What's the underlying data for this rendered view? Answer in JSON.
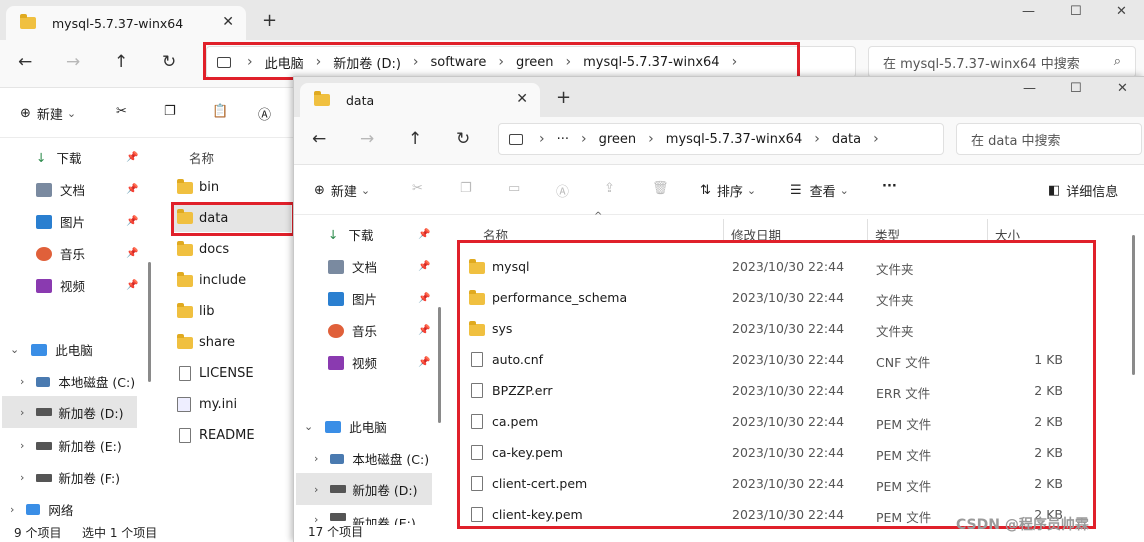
{
  "back_window": {
    "tab_title": "mysql-5.7.37-winx64",
    "breadcrumb": [
      "此电脑",
      "新加卷 (D:)",
      "software",
      "green",
      "mysql-5.7.37-winx64"
    ],
    "search_placeholder": "在 mysql-5.7.37-winx64 中搜索",
    "new_label": "新建",
    "sidebar": {
      "quick": [
        {
          "label": "下载"
        },
        {
          "label": "文档"
        },
        {
          "label": "图片"
        },
        {
          "label": "音乐"
        },
        {
          "label": "视频"
        }
      ],
      "this_pc": "此电脑",
      "drives": [
        {
          "label": "本地磁盘 (C:)"
        },
        {
          "label": "新加卷 (D:)"
        },
        {
          "label": "新加卷 (E:)"
        },
        {
          "label": "新加卷 (F:)"
        }
      ],
      "network": "网络"
    },
    "column_name": "名称",
    "files": [
      {
        "name": "bin",
        "type": "folder"
      },
      {
        "name": "data",
        "type": "folder"
      },
      {
        "name": "docs",
        "type": "folder"
      },
      {
        "name": "include",
        "type": "folder"
      },
      {
        "name": "lib",
        "type": "folder"
      },
      {
        "name": "share",
        "type": "folder"
      },
      {
        "name": "LICENSE",
        "type": "file"
      },
      {
        "name": "my.ini",
        "type": "ini"
      },
      {
        "name": "README",
        "type": "file"
      }
    ],
    "status_count": "9 个项目",
    "status_selected": "选中 1 个项目"
  },
  "front_window": {
    "tab_title": "data",
    "breadcrumb": [
      "···",
      "green",
      "mysql-5.7.37-winx64",
      "data"
    ],
    "search_placeholder": "在 data 中搜索",
    "toolbar": {
      "new_label": "新建",
      "sort_label": "排序",
      "view_label": "查看",
      "more_label": "···",
      "details_label": "详细信息"
    },
    "sidebar": {
      "quick": [
        {
          "label": "下载"
        },
        {
          "label": "文档"
        },
        {
          "label": "图片"
        },
        {
          "label": "音乐"
        },
        {
          "label": "视频"
        }
      ],
      "this_pc": "此电脑",
      "drives": [
        {
          "label": "本地磁盘 (C:)"
        },
        {
          "label": "新加卷 (D:)"
        },
        {
          "label": "新加卷 (E:)"
        }
      ]
    },
    "columns": {
      "name": "名称",
      "date": "修改日期",
      "type": "类型",
      "size": "大小"
    },
    "files": [
      {
        "name": "mysql",
        "date": "2023/10/30 22:44",
        "type": "文件夹",
        "size": "",
        "icon": "folder"
      },
      {
        "name": "performance_schema",
        "date": "2023/10/30 22:44",
        "type": "文件夹",
        "size": "",
        "icon": "folder"
      },
      {
        "name": "sys",
        "date": "2023/10/30 22:44",
        "type": "文件夹",
        "size": "",
        "icon": "folder"
      },
      {
        "name": "auto.cnf",
        "date": "2023/10/30 22:44",
        "type": "CNF 文件",
        "size": "1 KB",
        "icon": "file"
      },
      {
        "name": "BPZZP.err",
        "date": "2023/10/30 22:44",
        "type": "ERR 文件",
        "size": "2 KB",
        "icon": "file"
      },
      {
        "name": "ca.pem",
        "date": "2023/10/30 22:44",
        "type": "PEM 文件",
        "size": "2 KB",
        "icon": "file"
      },
      {
        "name": "ca-key.pem",
        "date": "2023/10/30 22:44",
        "type": "PEM 文件",
        "size": "2 KB",
        "icon": "file"
      },
      {
        "name": "client-cert.pem",
        "date": "2023/10/30 22:44",
        "type": "PEM 文件",
        "size": "2 KB",
        "icon": "file"
      },
      {
        "name": "client-key.pem",
        "date": "2023/10/30 22:44",
        "type": "PEM 文件",
        "size": "2 KB",
        "icon": "file"
      }
    ],
    "status_count": "17 个项目"
  },
  "watermark": "CSDN @程序员帅霖",
  "colors": {
    "highlight": "#e0202a",
    "folder": "#f0c040",
    "accent": "#3a8ee6"
  }
}
